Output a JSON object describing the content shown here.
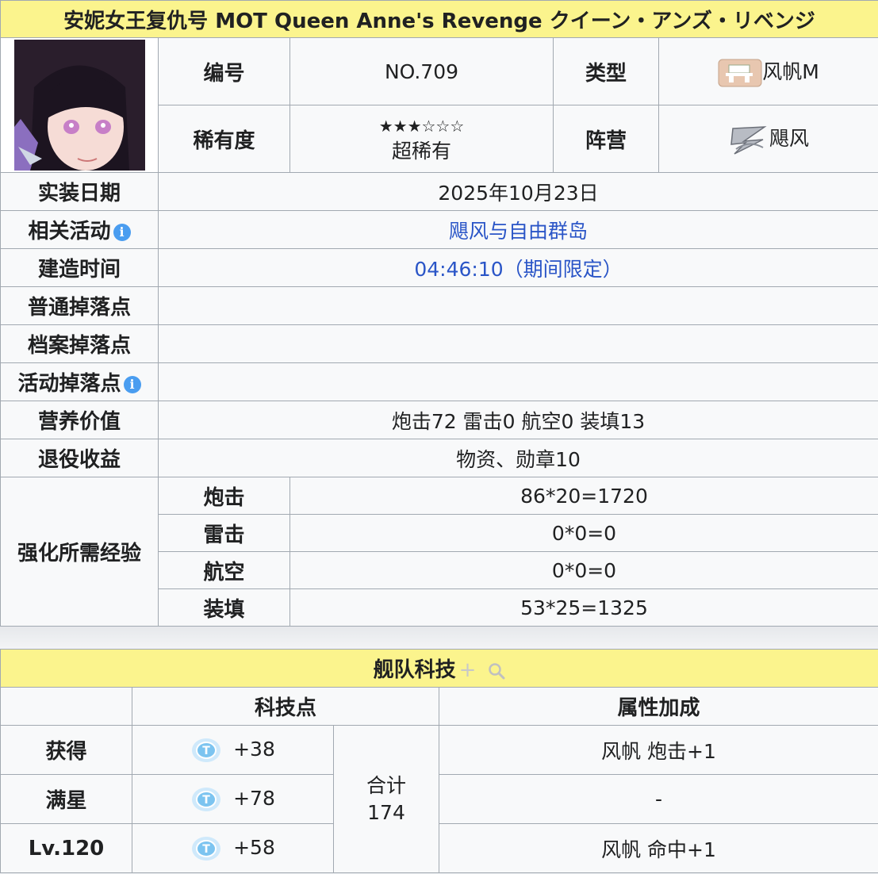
{
  "ship": {
    "title": "安妮女王复仇号 MOT Queen Anne's Revenge クイーン・アンズ・リベンジ",
    "portrait_icon": "character-portrait"
  },
  "labels": {
    "id": "编号",
    "type": "类型",
    "rarity": "稀有度",
    "faction": "阵营",
    "release_date": "实装日期",
    "related_event": "相关活动",
    "build_time": "建造时间",
    "normal_drop": "普通掉落点",
    "archive_drop": "档案掉落点",
    "event_drop": "活动掉落点",
    "nutrition": "营养价值",
    "retire": "退役收益",
    "enhance_exp": "强化所需经验"
  },
  "values": {
    "id": "NO.709",
    "type": "风帆M",
    "type_icon": "sail-ship-type-icon",
    "rarity_stars": "★★★☆☆☆",
    "rarity_name": "超稀有",
    "faction": "飓风",
    "faction_icon": "tempesta-faction-icon",
    "release_date": "2025年10月23日",
    "related_event": "飓风与自由群岛",
    "build_time": "04:46:10（期间限定）",
    "normal_drop": "",
    "archive_drop": "",
    "event_drop": "",
    "nutrition": "炮击72 雷击0 航空0 装填13",
    "retire": "物资、勋章10"
  },
  "info_icon_glyph": "i",
  "enhance_rows": [
    {
      "label": "炮击",
      "value": "86*20=1720"
    },
    {
      "label": "雷击",
      "value": "0*0=0"
    },
    {
      "label": "航空",
      "value": "0*0=0"
    },
    {
      "label": "装填",
      "value": "53*25=1325"
    }
  ],
  "tech": {
    "title": "舰队科技",
    "plus_glyph": "+",
    "search_icon": "search-icon",
    "col_points": "科技点",
    "col_bonus": "属性加成",
    "total_label": "合计",
    "total_value": "174",
    "rows": [
      {
        "label": "获得",
        "points": "+38",
        "bonus": "风帆 炮击+1"
      },
      {
        "label": "满星",
        "points": "+78",
        "bonus": "-"
      },
      {
        "label": "Lv.120",
        "points": "+58",
        "bonus": "风帆 命中+1"
      }
    ]
  }
}
